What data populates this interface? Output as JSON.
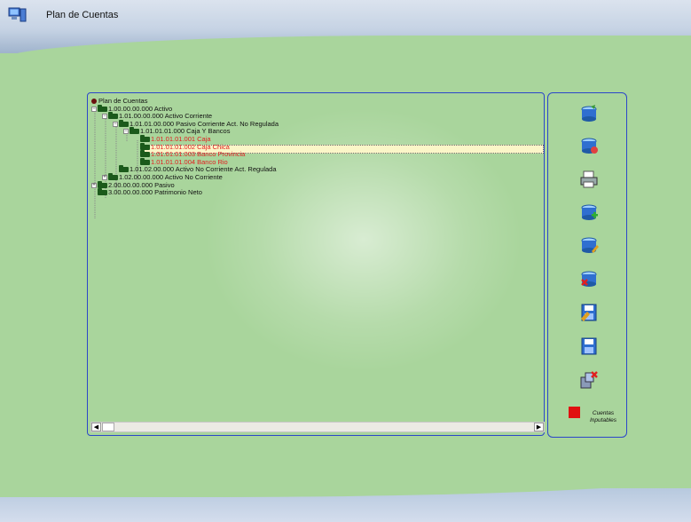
{
  "window": {
    "title": "Plan de Cuentas"
  },
  "tree": {
    "root": "Plan de Cuentas",
    "nodes": [
      {
        "label": "1.00.00.00.000 Activo",
        "level": 0,
        "expander": "−",
        "color": "normal"
      },
      {
        "label": "1.01.00.00.000 Activo Corriente",
        "level": 1,
        "expander": "−",
        "color": "normal"
      },
      {
        "label": "1.01.01.00.000 Pasivo Corriente Act. No Regulada",
        "level": 2,
        "expander": "−",
        "color": "normal"
      },
      {
        "label": "1.01.01.01.000 Caja Y Bancos",
        "level": 3,
        "expander": "−",
        "color": "normal"
      },
      {
        "label": "1.01.01.01.001 Caja",
        "level": 4,
        "expander": "",
        "color": "red"
      },
      {
        "label": "1.01.01.01.002 Caja Chica",
        "level": 4,
        "expander": "",
        "color": "red"
      },
      {
        "label": "1.01.01.01.003 Banco Provincia",
        "level": 4,
        "expander": "",
        "color": "red"
      },
      {
        "label": "1.01.01.01.004 Banco Rio",
        "level": 4,
        "expander": "",
        "color": "red"
      },
      {
        "label": "1.01.02.00.000 Activo No Corriente Act. Regulada",
        "level": 2,
        "expander": "",
        "color": "normal"
      },
      {
        "label": "1.02.00.00.000 Activo No Corriente",
        "level": 1,
        "expander": "+",
        "color": "normal"
      },
      {
        "label": "2.00.00.00.000 Pasivo",
        "level": 0,
        "expander": "+",
        "color": "normal"
      },
      {
        "label": "3.00.00.00.000 Patrimonio Neto",
        "level": 0,
        "expander": "",
        "color": "normal"
      }
    ]
  },
  "toolbar": {
    "buttons": [
      {
        "icon": "refresh-db-icon"
      },
      {
        "icon": "edit-db-icon"
      },
      {
        "icon": "print-icon"
      },
      {
        "icon": "add-db-icon"
      },
      {
        "icon": "modify-db-icon"
      },
      {
        "icon": "delete-db-icon"
      },
      {
        "icon": "save-as-icon"
      },
      {
        "icon": "save-icon"
      },
      {
        "icon": "exit-icon"
      }
    ]
  },
  "legend": {
    "label": "Cuentas Inputables",
    "color": "#e01010"
  },
  "colors": {
    "accent_border": "#2c46c9",
    "red_text": "#e02020",
    "background": "#a9d59c"
  }
}
